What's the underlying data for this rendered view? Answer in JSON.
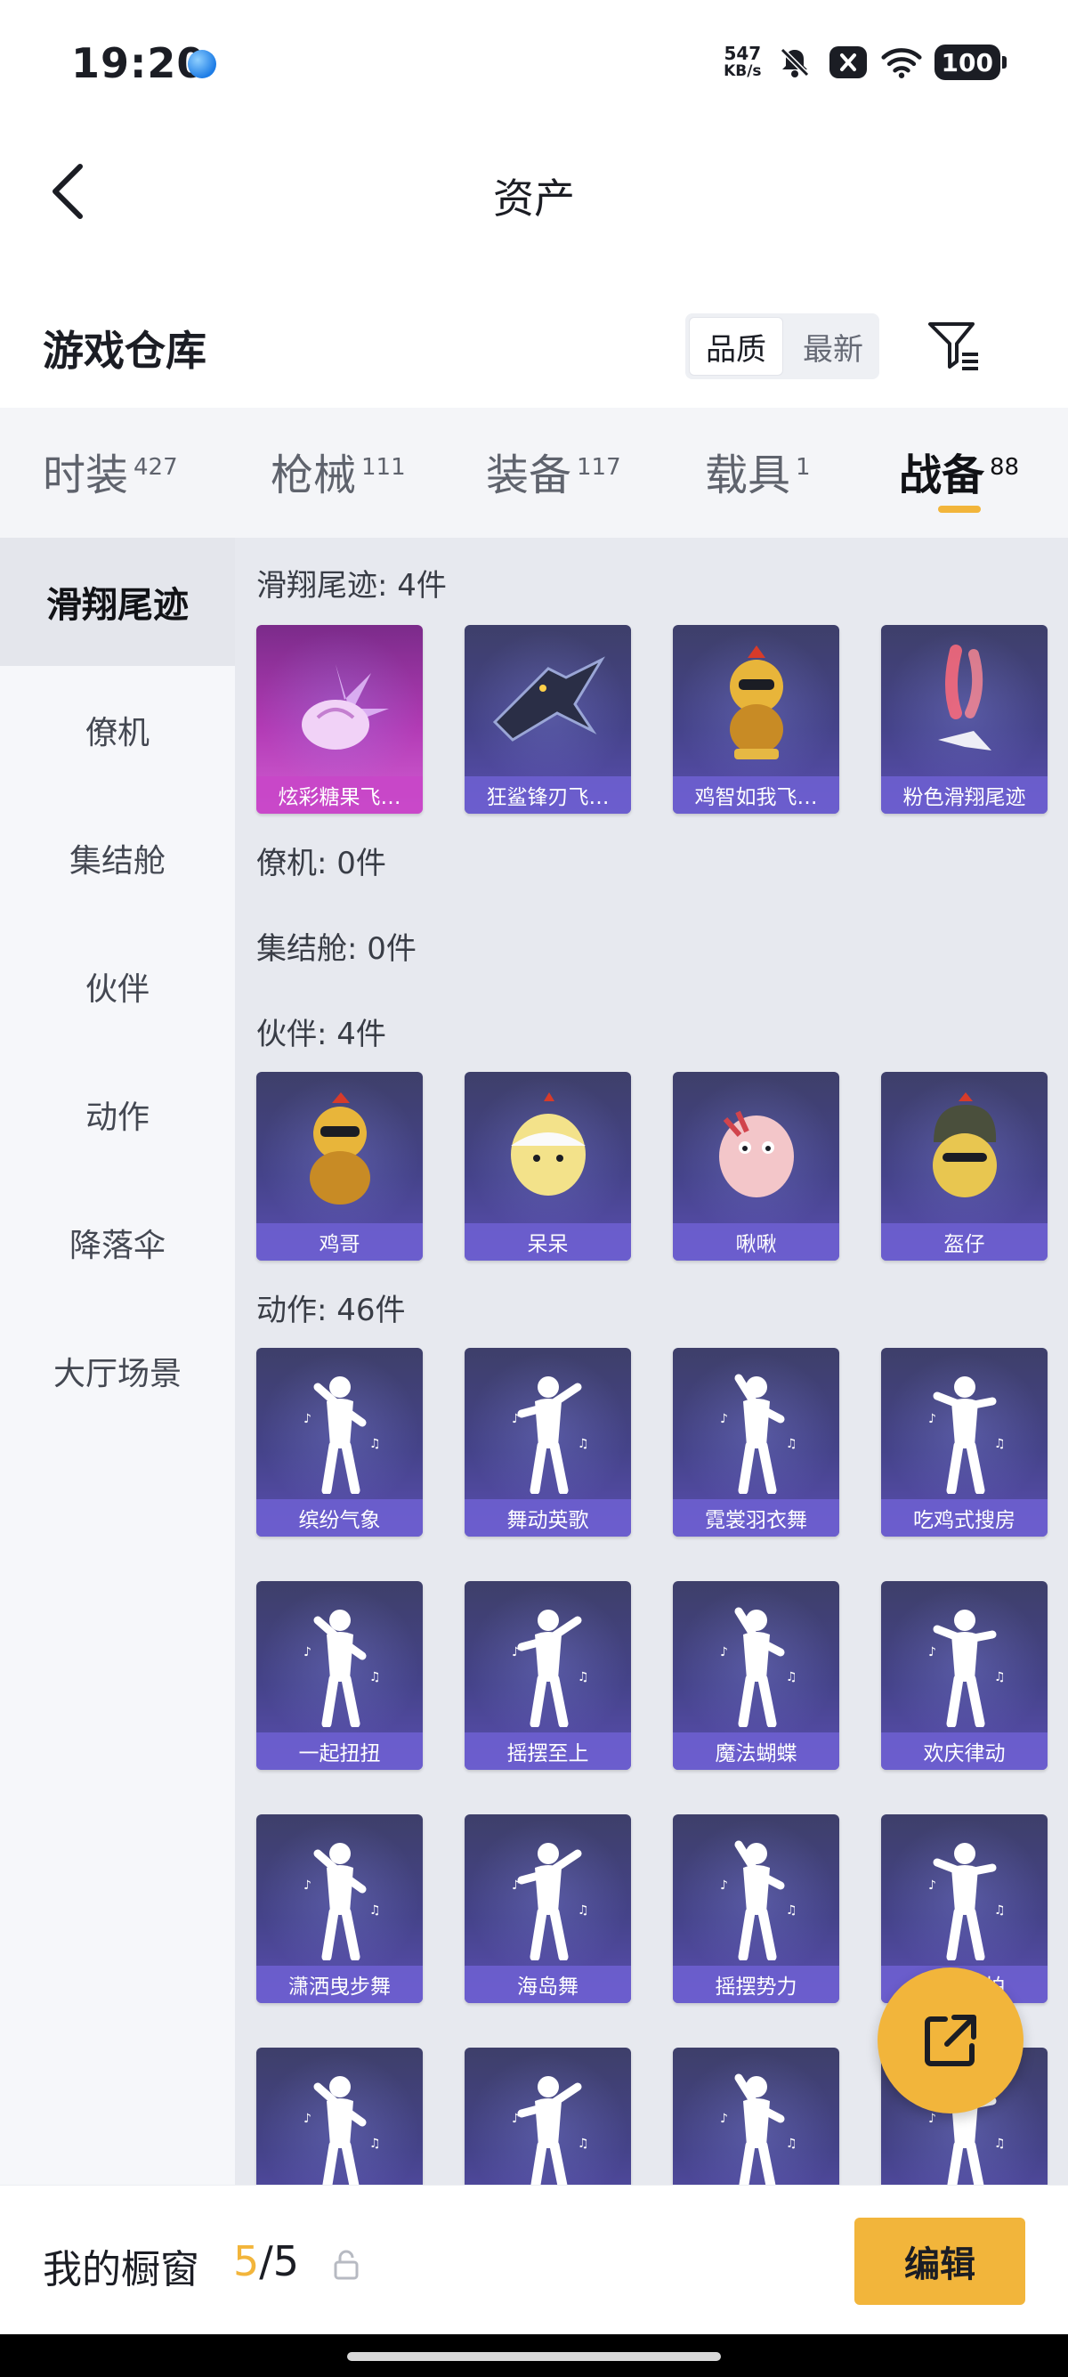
{
  "status_bar": {
    "time": "19:20",
    "net_speed_value": "547",
    "net_speed_unit": "KB/s",
    "battery": "100",
    "icons": [
      "globe-icon",
      "mute-icon",
      "close-box-icon",
      "wifi-icon",
      "battery-icon"
    ]
  },
  "nav": {
    "title": "资产"
  },
  "section": {
    "title": "游戏仓库",
    "sort_options": [
      "品质",
      "最新"
    ],
    "sort_selected": "品质"
  },
  "category_tabs": [
    {
      "label": "时装",
      "count": "427"
    },
    {
      "label": "枪械",
      "count": "111"
    },
    {
      "label": "装备",
      "count": "117"
    },
    {
      "label": "载具",
      "count": "1"
    },
    {
      "label": "战备",
      "count": "88",
      "active": true
    }
  ],
  "sidebar": {
    "items": [
      "滑翔尾迹",
      "僚机",
      "集结舱",
      "伙伴",
      "动作",
      "降落伞",
      "大厅场景"
    ],
    "selected": "滑翔尾迹"
  },
  "groups": {
    "glide_trail": {
      "label": "滑翔尾迹: 4件",
      "items": [
        "炫彩糖果飞…",
        "狂鲨锋刃飞…",
        "鸡智如我飞…",
        "粉色滑翔尾迹"
      ]
    },
    "wingman": {
      "label": "僚机: 0件"
    },
    "assembly_pod": {
      "label": "集结舱: 0件"
    },
    "companion": {
      "label": "伙伴: 4件",
      "items": [
        "鸡哥",
        "呆呆",
        "啾啾",
        "盔仔"
      ]
    },
    "emote": {
      "label": "动作: 46件",
      "items": [
        "缤纷气象",
        "舞动英歌",
        "霓裳羽衣舞",
        "吃鸡式搜房",
        "一起扭扭",
        "摇摆至上",
        "魔法蝴蝶",
        "欢庆律动",
        "潇洒曳步舞",
        "海岛舞",
        "摇摆势力",
        "比…连拍",
        "",
        "",
        "",
        ""
      ]
    }
  },
  "bottom_bar": {
    "showcase_label": "我的橱窗",
    "showcase_current": "5",
    "showcase_total": "/5",
    "edit_label": "编辑"
  },
  "colors": {
    "accent": "#f2b53b",
    "card": "#45438a",
    "card_special": "#b23bb5"
  }
}
